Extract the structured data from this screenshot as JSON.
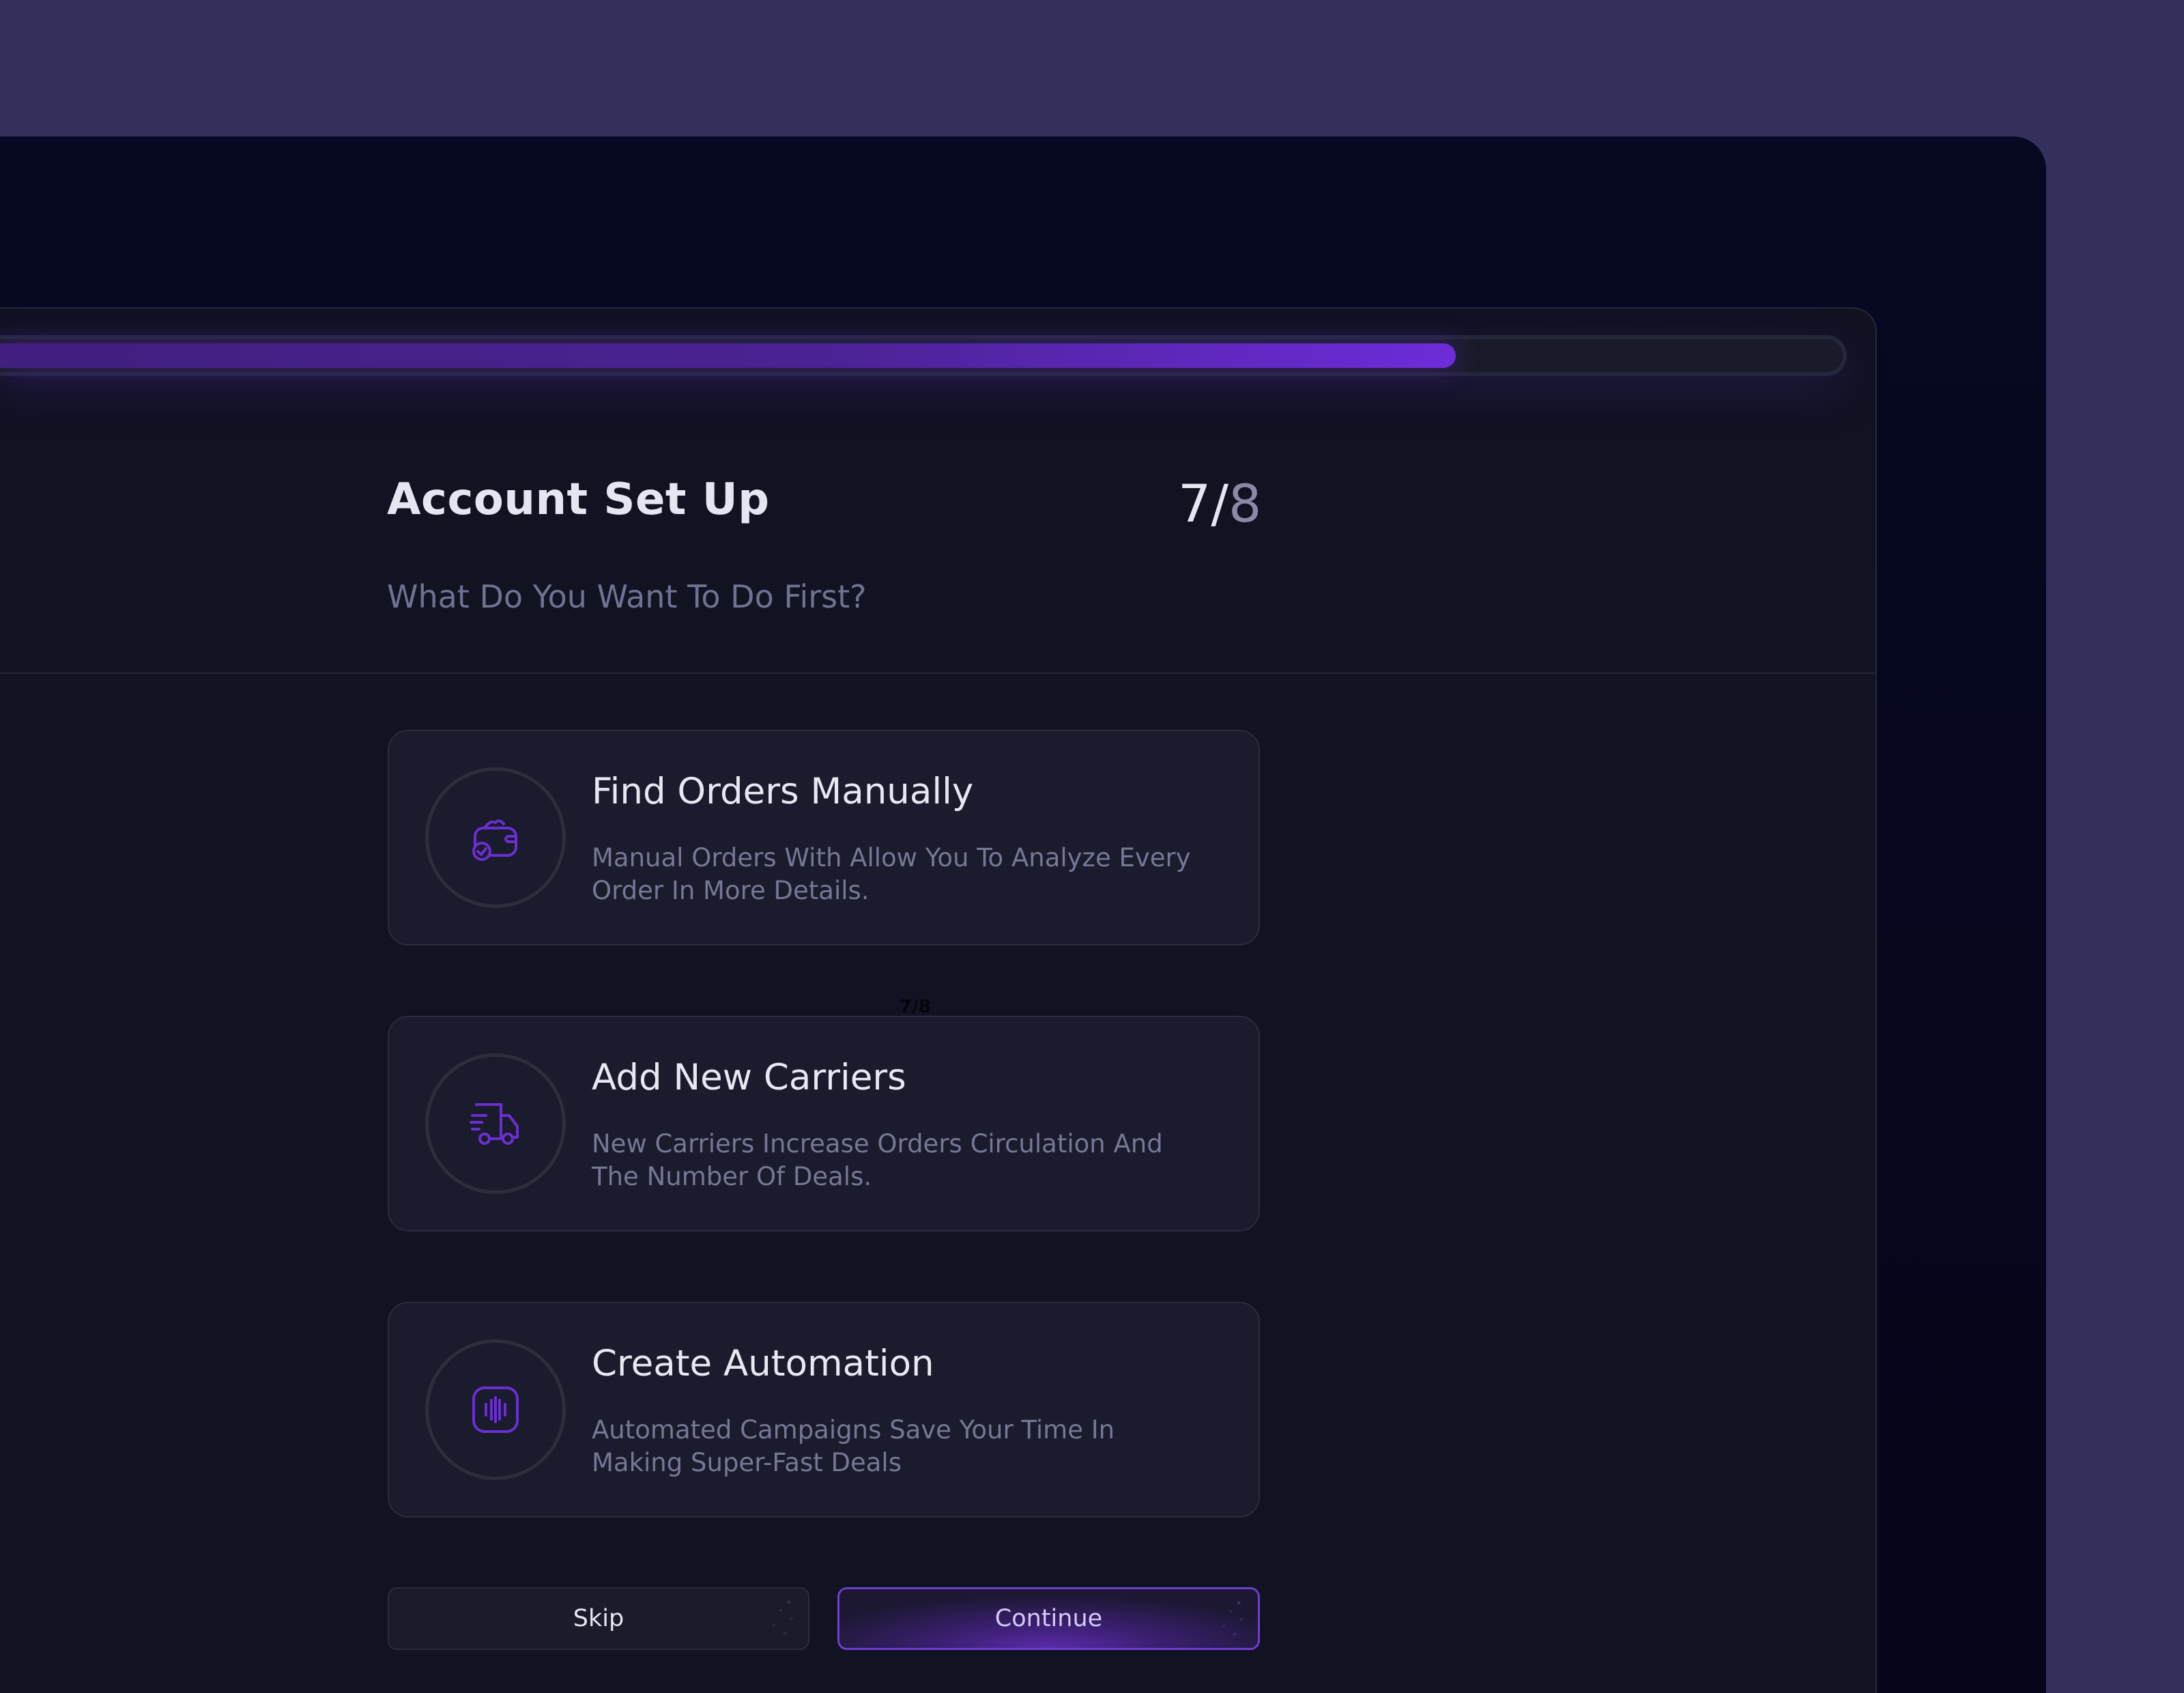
{
  "header": {
    "title": "Account Set Up",
    "step_current": "7/",
    "step_total": "8",
    "subtitle": "What Do You Want To Do First?"
  },
  "progress": {
    "value_fraction": 0.79
  },
  "options": [
    {
      "title": "Find Orders Manually",
      "description": "Manual Orders With Allow You To Analyze Every Order In More Details.",
      "icon": "wallet-check-icon"
    },
    {
      "title": "Add New Carriers",
      "description": "New Carriers Increase Orders Circulation And The Number Of Deals.",
      "icon": "delivery-truck-icon"
    },
    {
      "title": "Create Automation",
      "description": "Automated Campaigns Save Your Time In Making Super-Fast Deals",
      "icon": "automation-icon"
    }
  ],
  "stray_label": "7/8",
  "actions": {
    "skip_label": "Skip",
    "continue_label": "Continue"
  },
  "colors": {
    "background": "#33315c",
    "panel": "#111222",
    "accent": "#6c2cd9",
    "card": "#1a1b2c",
    "title_text": "#e6e6f2",
    "muted_text": "#777796"
  }
}
